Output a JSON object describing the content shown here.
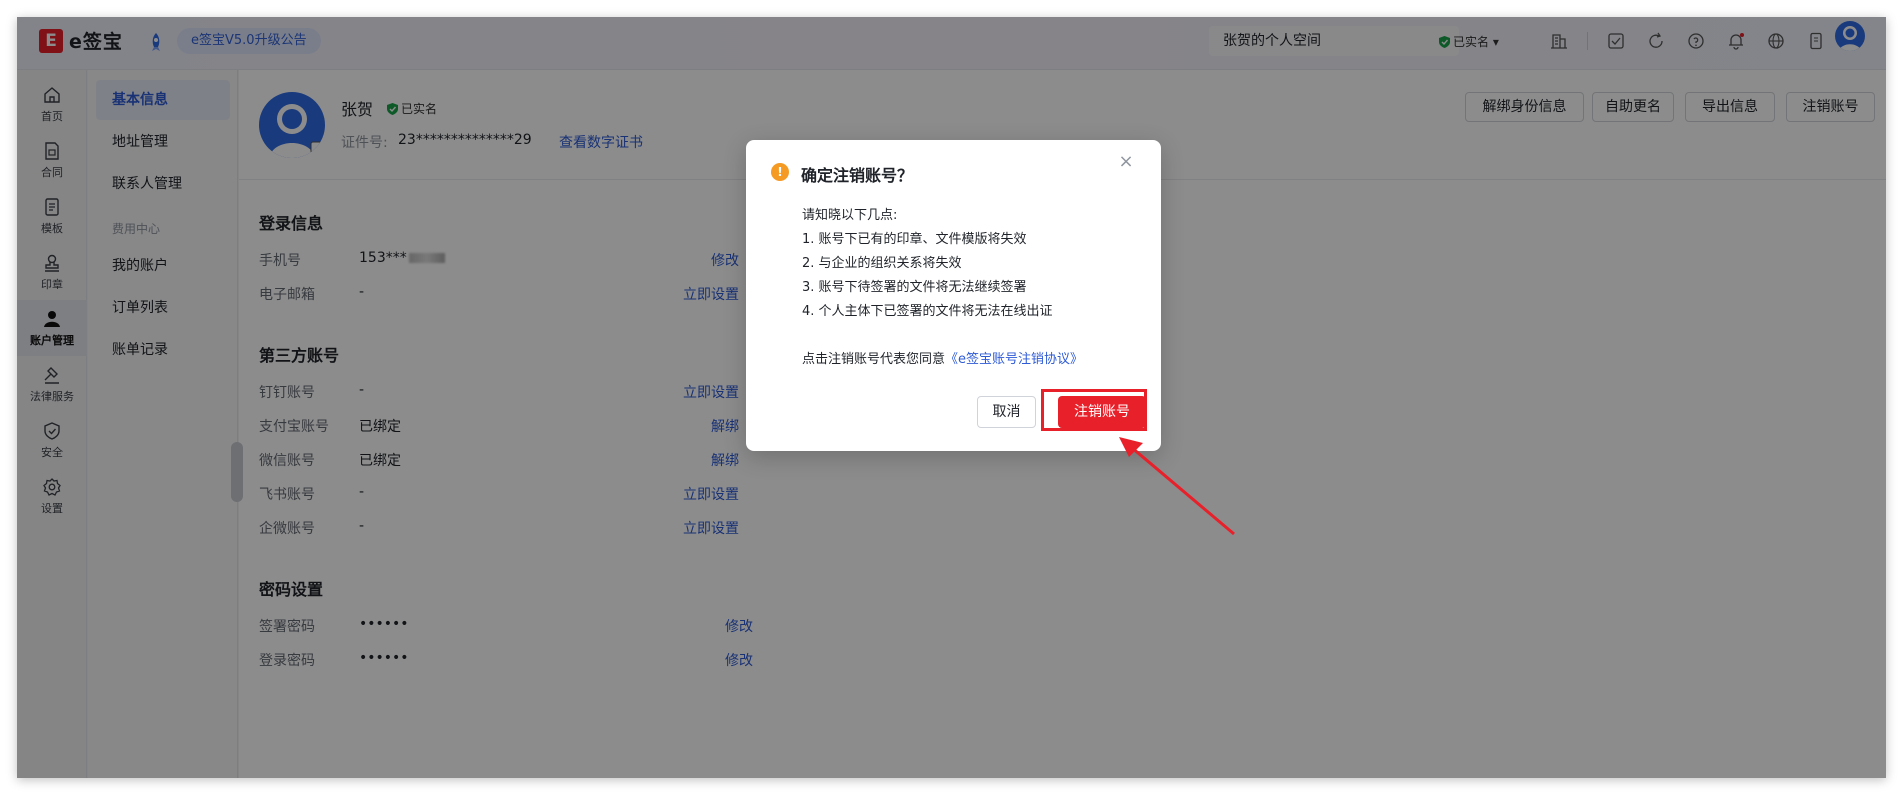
{
  "topbar": {
    "logo_mark": "E",
    "logo_text": "e签宝",
    "announcement": "e签宝V5.0升级公告",
    "space_name": "张贺的个人空间",
    "verified": "已实名 ▾"
  },
  "rail": [
    {
      "label": "首页",
      "icon": "home-icon"
    },
    {
      "label": "合同",
      "icon": "contract-icon"
    },
    {
      "label": "模板",
      "icon": "template-icon"
    },
    {
      "label": "印章",
      "icon": "seal-icon"
    },
    {
      "label": "账户管理",
      "icon": "user-icon",
      "active": true
    },
    {
      "label": "法律服务",
      "icon": "gavel-icon"
    },
    {
      "label": "安全",
      "icon": "shield-icon"
    },
    {
      "label": "设置",
      "icon": "gear-icon"
    }
  ],
  "subnav": {
    "items": [
      "基本信息",
      "地址管理",
      "联系人管理"
    ],
    "finance_header": "费用中心",
    "finance_items": [
      "我的账户",
      "订单列表",
      "账单记录"
    ]
  },
  "profile": {
    "name": "张贺",
    "verified": "已实名",
    "id_label": "证件号:",
    "id_value": "23**************29",
    "cert_link": "查看数字证书"
  },
  "actions": {
    "unbind": "解绑身份信息",
    "rename": "自助更名",
    "export": "导出信息",
    "cancel_account": "注销账号"
  },
  "login": {
    "title": "登录信息",
    "phone_label": "手机号",
    "phone_value": "153***",
    "phone_action": "修改",
    "email_label": "电子邮箱",
    "email_value": "-",
    "email_action": "立即设置"
  },
  "third_party": {
    "title": "第三方账号",
    "rows": [
      {
        "label": "钉钉账号",
        "value": "-",
        "action": "立即设置"
      },
      {
        "label": "支付宝账号",
        "value": "已绑定",
        "action": "解绑"
      },
      {
        "label": "微信账号",
        "value": "已绑定",
        "action": "解绑"
      },
      {
        "label": "飞书账号",
        "value": "-",
        "action": "立即设置"
      },
      {
        "label": "企微账号",
        "value": "-",
        "action": "立即设置"
      }
    ]
  },
  "password": {
    "title": "密码设置",
    "rows": [
      {
        "label": "签署密码",
        "value": "••••••",
        "action": "修改"
      },
      {
        "label": "登录密码",
        "value": "••••••",
        "action": "修改"
      }
    ]
  },
  "dialog": {
    "title": "确定注销账号？",
    "intro": "请知晓以下几点:",
    "points": [
      "1. 账号下已有的印章、文件模版将失效",
      "2. 与企业的组织关系将失效",
      "3. 账号下待签署的文件将无法继续签署",
      "4. 个人主体下已签署的文件将无法在线出证"
    ],
    "agree_prefix": "点击注销账号代表您同意",
    "agree_link": "《e签宝账号注销协议》",
    "cancel": "取消",
    "confirm": "注销账号"
  },
  "colors": {
    "brand_red": "#e8202a",
    "link_blue": "#2e5bd6",
    "warn_orange": "#f59a23"
  }
}
